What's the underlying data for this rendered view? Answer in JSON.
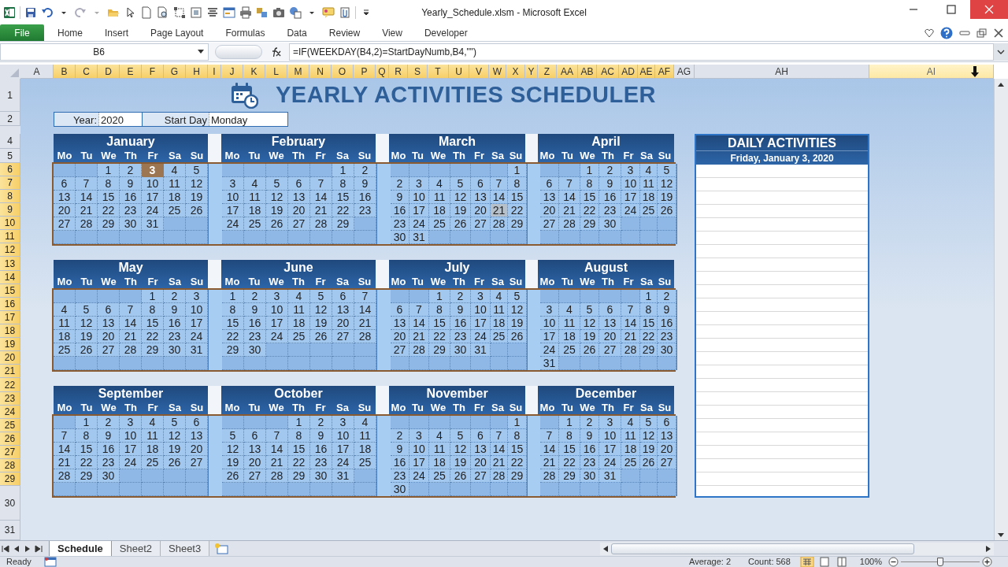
{
  "window": {
    "title": "Yearly_Schedule.xlsm  -  Microsoft Excel"
  },
  "ribbon_tabs": [
    {
      "label": "File",
      "kind": "file",
      "selected": false
    },
    {
      "label": "Home",
      "kind": "tab",
      "selected": false
    },
    {
      "label": "Insert",
      "kind": "tab",
      "selected": false
    },
    {
      "label": "Page Layout",
      "kind": "tab",
      "selected": false
    },
    {
      "label": "Formulas",
      "kind": "tab",
      "selected": false
    },
    {
      "label": "Data",
      "kind": "tab",
      "selected": false
    },
    {
      "label": "Review",
      "kind": "tab",
      "selected": false
    },
    {
      "label": "View",
      "kind": "tab",
      "selected": false
    },
    {
      "label": "Developer",
      "kind": "tab",
      "selected": false
    }
  ],
  "name_box": "B6",
  "formula": "=IF(WEEKDAY(B4,2)=StartDayNumb,B4,\"\")",
  "columns": [
    {
      "label": "A",
      "selected": false,
      "hover": false
    },
    {
      "label": "B",
      "selected": true,
      "hover": false
    },
    {
      "label": "C",
      "selected": true,
      "hover": false
    },
    {
      "label": "D",
      "selected": true,
      "hover": false
    },
    {
      "label": "E",
      "selected": true,
      "hover": false
    },
    {
      "label": "F",
      "selected": true,
      "hover": false
    },
    {
      "label": "G",
      "selected": true,
      "hover": false
    },
    {
      "label": "H",
      "selected": true,
      "hover": false
    },
    {
      "label": "I",
      "selected": true,
      "hover": false
    },
    {
      "label": "J",
      "selected": true,
      "hover": false
    },
    {
      "label": "K",
      "selected": true,
      "hover": false
    },
    {
      "label": "L",
      "selected": true,
      "hover": false
    },
    {
      "label": "M",
      "selected": true,
      "hover": false
    },
    {
      "label": "N",
      "selected": true,
      "hover": false
    },
    {
      "label": "O",
      "selected": true,
      "hover": false
    },
    {
      "label": "P",
      "selected": true,
      "hover": false
    },
    {
      "label": "Q",
      "selected": true,
      "hover": false
    },
    {
      "label": "R",
      "selected": true,
      "hover": false
    },
    {
      "label": "S",
      "selected": true,
      "hover": false
    },
    {
      "label": "T",
      "selected": true,
      "hover": false
    },
    {
      "label": "U",
      "selected": true,
      "hover": false
    },
    {
      "label": "V",
      "selected": true,
      "hover": false
    },
    {
      "label": "W",
      "selected": true,
      "hover": false
    },
    {
      "label": "X",
      "selected": true,
      "hover": false
    },
    {
      "label": "Y",
      "selected": true,
      "hover": false
    },
    {
      "label": "Z",
      "selected": true,
      "hover": false
    },
    {
      "label": "AA",
      "selected": true,
      "hover": false
    },
    {
      "label": "AB",
      "selected": true,
      "hover": false
    },
    {
      "label": "AC",
      "selected": true,
      "hover": false
    },
    {
      "label": "AD",
      "selected": true,
      "hover": false
    },
    {
      "label": "AE",
      "selected": true,
      "hover": false
    },
    {
      "label": "AF",
      "selected": true,
      "hover": false
    },
    {
      "label": "AG",
      "selected": false,
      "hover": false
    },
    {
      "label": "AH",
      "selected": false,
      "hover": false
    },
    {
      "label": "AI",
      "selected": false,
      "hover": true
    }
  ],
  "rows": [
    {
      "label": "1",
      "selected": false
    },
    {
      "label": "2",
      "selected": false
    },
    {
      "label": "4",
      "selected": false
    },
    {
      "label": "5",
      "selected": false
    },
    {
      "label": "6",
      "selected": true
    },
    {
      "label": "7",
      "selected": true
    },
    {
      "label": "8",
      "selected": true
    },
    {
      "label": "9",
      "selected": true
    },
    {
      "label": "10",
      "selected": true
    },
    {
      "label": "11",
      "selected": true
    },
    {
      "label": "12",
      "selected": true
    },
    {
      "label": "13",
      "selected": true
    },
    {
      "label": "14",
      "selected": true
    },
    {
      "label": "15",
      "selected": true
    },
    {
      "label": "16",
      "selected": true
    },
    {
      "label": "17",
      "selected": true
    },
    {
      "label": "18",
      "selected": true
    },
    {
      "label": "19",
      "selected": true
    },
    {
      "label": "20",
      "selected": true
    },
    {
      "label": "21",
      "selected": true
    },
    {
      "label": "22",
      "selected": true
    },
    {
      "label": "23",
      "selected": true
    },
    {
      "label": "24",
      "selected": true
    },
    {
      "label": "25",
      "selected": true
    },
    {
      "label": "26",
      "selected": true
    },
    {
      "label": "27",
      "selected": true
    },
    {
      "label": "28",
      "selected": true
    },
    {
      "label": "29",
      "selected": true
    },
    {
      "label": "30",
      "selected": false
    },
    {
      "label": "31",
      "selected": false
    }
  ],
  "title": "YEARLY ACTIVITIES SCHEDULER",
  "inputs": {
    "year_label": "Year:",
    "year": "2020",
    "start_label": "Start Day",
    "start_day": "Monday"
  },
  "months": [
    {
      "name": "January",
      "weekdays": [
        "Mo",
        "Tu",
        "We",
        "Th",
        "Fr",
        "Sa",
        "Su"
      ],
      "weeks": [
        [
          "1",
          "2",
          {
            "day": "3",
            "kind": "selected"
          },
          "4",
          "5"
        ],
        [
          "6",
          "7",
          "8",
          "9",
          "10",
          "11",
          "12"
        ],
        [
          "13",
          "14",
          "15",
          "16",
          "17",
          "18",
          "19"
        ],
        [
          "20",
          "21",
          "22",
          "23",
          "24",
          "25",
          "26"
        ],
        [
          "27",
          "28",
          "29",
          "30",
          "31"
        ]
      ]
    },
    {
      "name": "February",
      "weekdays": [
        "Mo",
        "Tu",
        "We",
        "Th",
        "Fr",
        "Sa",
        "Su"
      ],
      "weeks": [
        [
          "1",
          "2"
        ],
        [
          "3",
          "4",
          "5",
          "6",
          "7",
          "8",
          "9"
        ],
        [
          "10",
          "11",
          "12",
          "13",
          "14",
          "15",
          "16"
        ],
        [
          "17",
          "18",
          "19",
          "20",
          "21",
          "22",
          "23"
        ],
        [
          "24",
          "25",
          "26",
          "27",
          "28",
          "29"
        ]
      ]
    },
    {
      "name": "March",
      "weekdays": [
        "Mo",
        "Tu",
        "We",
        "Th",
        "Fr",
        "Sa",
        "Su"
      ],
      "weeks": [
        [
          "1"
        ],
        [
          "2",
          "3",
          "4",
          "5",
          "6",
          "7",
          "8"
        ],
        [
          "9",
          "10",
          "11",
          "12",
          "13",
          "14",
          "15"
        ],
        [
          "16",
          "17",
          "18",
          "19",
          "20",
          {
            "day": "21",
            "kind": "hover"
          },
          "22"
        ],
        [
          "23",
          "24",
          "25",
          "26",
          "27",
          "28",
          "29"
        ],
        [
          "30",
          "31"
        ]
      ]
    },
    {
      "name": "April",
      "weekdays": [
        "Mo",
        "Tu",
        "We",
        "Th",
        "Fr",
        "Sa",
        "Su"
      ],
      "weeks": [
        [
          "1",
          "2",
          "3",
          "4",
          "5"
        ],
        [
          "6",
          "7",
          "8",
          "9",
          "10",
          "11",
          "12"
        ],
        [
          "13",
          "14",
          "15",
          "16",
          "17",
          "18",
          "19"
        ],
        [
          "20",
          "21",
          "22",
          "23",
          "24",
          "25",
          "26"
        ],
        [
          "27",
          "28",
          "29",
          "30"
        ]
      ]
    },
    {
      "name": "May",
      "weekdays": [
        "Mo",
        "Tu",
        "We",
        "Th",
        "Fr",
        "Sa",
        "Su"
      ],
      "weeks": [
        [
          "1",
          "2",
          "3"
        ],
        [
          "4",
          "5",
          "6",
          "7",
          "8",
          "9",
          "10"
        ],
        [
          "11",
          "12",
          "13",
          "14",
          "15",
          "16",
          "17"
        ],
        [
          "18",
          "19",
          "20",
          "21",
          "22",
          "23",
          "24"
        ],
        [
          "25",
          "26",
          "27",
          "28",
          "29",
          "30",
          "31"
        ]
      ]
    },
    {
      "name": "June",
      "weekdays": [
        "Mo",
        "Tu",
        "We",
        "Th",
        "Fr",
        "Sa",
        "Su"
      ],
      "weeks": [
        [
          "1",
          "2",
          "3",
          "4",
          "5",
          "6",
          "7"
        ],
        [
          "8",
          "9",
          "10",
          "11",
          "12",
          "13",
          "14"
        ],
        [
          "15",
          "16",
          "17",
          "18",
          "19",
          "20",
          "21"
        ],
        [
          "22",
          "23",
          "24",
          "25",
          "26",
          "27",
          "28"
        ],
        [
          "29",
          "30"
        ]
      ]
    },
    {
      "name": "July",
      "weekdays": [
        "Mo",
        "Tu",
        "We",
        "Th",
        "Fr",
        "Sa",
        "Su"
      ],
      "weeks": [
        [
          "1",
          "2",
          "3",
          "4",
          "5"
        ],
        [
          "6",
          "7",
          "8",
          "9",
          "10",
          "11",
          "12"
        ],
        [
          "13",
          "14",
          "15",
          "16",
          "17",
          "18",
          "19"
        ],
        [
          "20",
          "21",
          "22",
          "23",
          "24",
          "25",
          "26"
        ],
        [
          "27",
          "28",
          "29",
          "30",
          "31"
        ]
      ]
    },
    {
      "name": "August",
      "weekdays": [
        "Mo",
        "Tu",
        "We",
        "Th",
        "Fr",
        "Sa",
        "Su"
      ],
      "weeks": [
        [
          "1",
          "2"
        ],
        [
          "3",
          "4",
          "5",
          "6",
          "7",
          "8",
          "9"
        ],
        [
          "10",
          "11",
          "12",
          "13",
          "14",
          "15",
          "16"
        ],
        [
          "17",
          "18",
          "19",
          "20",
          "21",
          "22",
          "23"
        ],
        [
          "24",
          "25",
          "26",
          "27",
          "28",
          "29",
          "30"
        ],
        [
          "31"
        ]
      ]
    },
    {
      "name": "September",
      "weekdays": [
        "Mo",
        "Tu",
        "We",
        "Th",
        "Fr",
        "Sa",
        "Su"
      ],
      "weeks": [
        [
          "1",
          "2",
          "3",
          "4",
          "5",
          "6"
        ],
        [
          "7",
          "8",
          "9",
          "10",
          "11",
          "12",
          "13"
        ],
        [
          "14",
          "15",
          "16",
          "17",
          "18",
          "19",
          "20"
        ],
        [
          "21",
          "22",
          "23",
          "24",
          "25",
          "26",
          "27"
        ],
        [
          "28",
          "29",
          "30"
        ]
      ]
    },
    {
      "name": "October",
      "weekdays": [
        "Mo",
        "Tu",
        "We",
        "Th",
        "Fr",
        "Sa",
        "Su"
      ],
      "weeks": [
        [
          "1",
          "2",
          "3",
          "4"
        ],
        [
          "5",
          "6",
          "7",
          "8",
          "9",
          "10",
          "11"
        ],
        [
          "12",
          "13",
          "14",
          "15",
          "16",
          "17",
          "18"
        ],
        [
          "19",
          "20",
          "21",
          "22",
          "23",
          "24",
          "25"
        ],
        [
          "26",
          "27",
          "28",
          "29",
          "30",
          "31"
        ]
      ]
    },
    {
      "name": "November",
      "weekdays": [
        "Mo",
        "Tu",
        "We",
        "Th",
        "Fr",
        "Sa",
        "Su"
      ],
      "weeks": [
        [
          "1"
        ],
        [
          "2",
          "3",
          "4",
          "5",
          "6",
          "7",
          "8"
        ],
        [
          "9",
          "10",
          "11",
          "12",
          "13",
          "14",
          "15"
        ],
        [
          "16",
          "17",
          "18",
          "19",
          "20",
          "21",
          "22"
        ],
        [
          "23",
          "24",
          "25",
          "26",
          "27",
          "28",
          "29"
        ],
        [
          "30"
        ]
      ]
    },
    {
      "name": "December",
      "weekdays": [
        "Mo",
        "Tu",
        "We",
        "Th",
        "Fr",
        "Sa",
        "Su"
      ],
      "weeks": [
        [
          "1",
          "2",
          "3",
          "4",
          "5",
          "6"
        ],
        [
          "7",
          "8",
          "9",
          "10",
          "11",
          "12",
          "13"
        ],
        [
          "14",
          "15",
          "16",
          "17",
          "18",
          "19",
          "20"
        ],
        [
          "21",
          "22",
          "23",
          "24",
          "25",
          "26",
          "27"
        ],
        [
          "28",
          "29",
          "30",
          "31"
        ]
      ]
    }
  ],
  "daily": {
    "title": "DAILY ACTIVITIES",
    "date": "Friday, January 3, 2020"
  },
  "sheet_tabs": [
    {
      "label": "Schedule",
      "selected": true
    },
    {
      "label": "Sheet2",
      "selected": false
    },
    {
      "label": "Sheet3",
      "selected": false
    }
  ],
  "status": {
    "ready": "Ready",
    "average": "Average: 2",
    "count": "Count: 568",
    "zoom": "100%"
  },
  "zoom_slider": {
    "level": 0.5
  }
}
